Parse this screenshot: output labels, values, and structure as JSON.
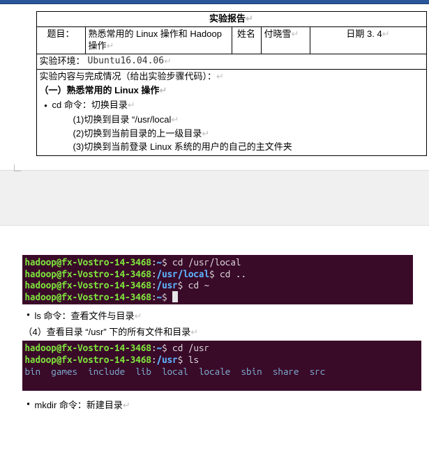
{
  "report": {
    "title": "实验报告",
    "row1": {
      "topic_lbl": "题目：",
      "topic_val": "熟悉常用的 Linux 操作和 Hadoop 操作",
      "name_lbl": "姓名",
      "name_val": "付晓雪",
      "date_lbl": "日期 3. 4"
    },
    "env": {
      "lbl": "实验环境：",
      "val": "Ubuntu16.04.06"
    },
    "content_hdr": "实验内容与完成情况（给出实验步骤代码）：",
    "section1": "（一）熟悉常用的 Linux 操作",
    "cd_line": "cd 命令：切换目录",
    "steps": [
      "(1)切换到目录 “/usr/local",
      "(2)切换到当前目录的上一级目录",
      "(3)切换到当前登录 Linux 系统的用户的自己的主文件夹"
    ]
  },
  "terminal1": {
    "l1": {
      "user": "hadoop@fx-Vostro-14-3468",
      "path": "~",
      "cmd": "cd /usr/local"
    },
    "l2": {
      "user": "hadoop@fx-Vostro-14-3468",
      "path": "/usr/local",
      "cmd": "cd .."
    },
    "l3": {
      "user": "hadoop@fx-Vostro-14-3468",
      "path": "/usr",
      "cmd": "cd ~"
    },
    "l4": {
      "user": "hadoop@fx-Vostro-14-3468",
      "path": "~"
    }
  },
  "ls_line": "ls 命令：查看文件与目录",
  "step4": "（4）查看目录 “/usr” 下的所有文件和目录",
  "terminal2": {
    "l1": {
      "user": "hadoop@fx-Vostro-14-3468",
      "path": "~",
      "cmd": "cd /usr"
    },
    "l2": {
      "user": "hadoop@fx-Vostro-14-3468",
      "path": "/usr",
      "cmd": "ls"
    },
    "out": "bin  games  include  lib  local  locale  sbin  share  src"
  },
  "mkdir_line": "mkdir 命令：新建目录",
  "pm": "↵"
}
